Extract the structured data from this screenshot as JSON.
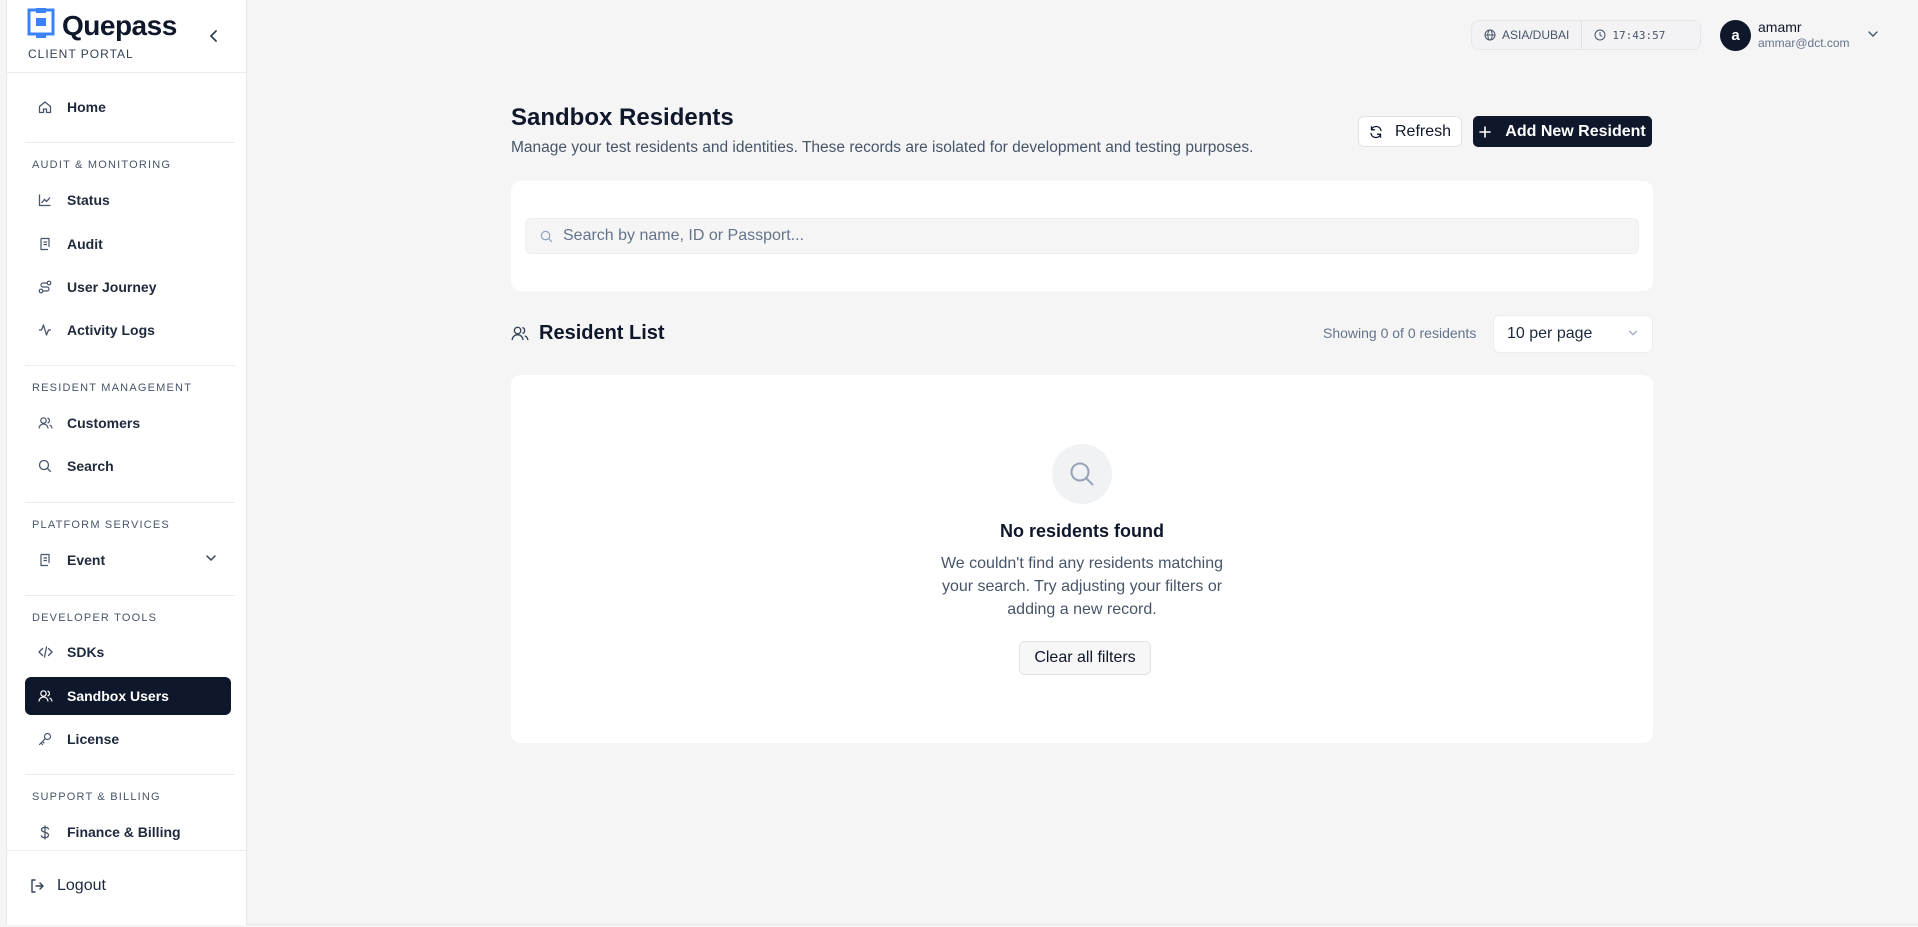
{
  "brand": {
    "name": "Quepass",
    "subtitle": "CLIENT PORTAL"
  },
  "sidebar": {
    "home": "Home",
    "sections": [
      {
        "label": "AUDIT & MONITORING",
        "items": [
          "Status",
          "Audit",
          "User Journey",
          "Activity Logs"
        ]
      },
      {
        "label": "RESIDENT MANAGEMENT",
        "items": [
          "Customers",
          "Search"
        ]
      },
      {
        "label": "PLATFORM SERVICES",
        "items": [
          "Event"
        ]
      },
      {
        "label": "DEVELOPER TOOLS",
        "items": [
          "SDKs",
          "Sandbox Users",
          "License"
        ]
      },
      {
        "label": "SUPPORT & BILLING",
        "items": [
          "Finance & Billing"
        ]
      }
    ],
    "active_item": "Sandbox Users",
    "logout": "Logout"
  },
  "topbar": {
    "timezone": "ASIA/DUBAI",
    "time": "17:43:57",
    "user": {
      "initial": "a",
      "name": "amamr",
      "email": "ammar@dct.com"
    }
  },
  "main": {
    "title": "Sandbox Residents",
    "subtitle": "Manage your test residents and identities. These records are isolated for development and testing purposes.",
    "refresh_label": "Refresh",
    "add_label": "Add New Resident",
    "search_placeholder": "Search by name, ID or Passport...",
    "list_title": "Resident List",
    "showing_text": "Showing 0 of 0 residents",
    "per_page": "10 per page",
    "empty": {
      "title": "No residents found",
      "text": "We couldn't find any residents matching your search. Try adjusting your filters or adding a new record.",
      "clear_label": "Clear all filters"
    }
  },
  "colors": {
    "primary": "#0f172a",
    "background": "#f5f5f6",
    "muted": "#475569"
  }
}
